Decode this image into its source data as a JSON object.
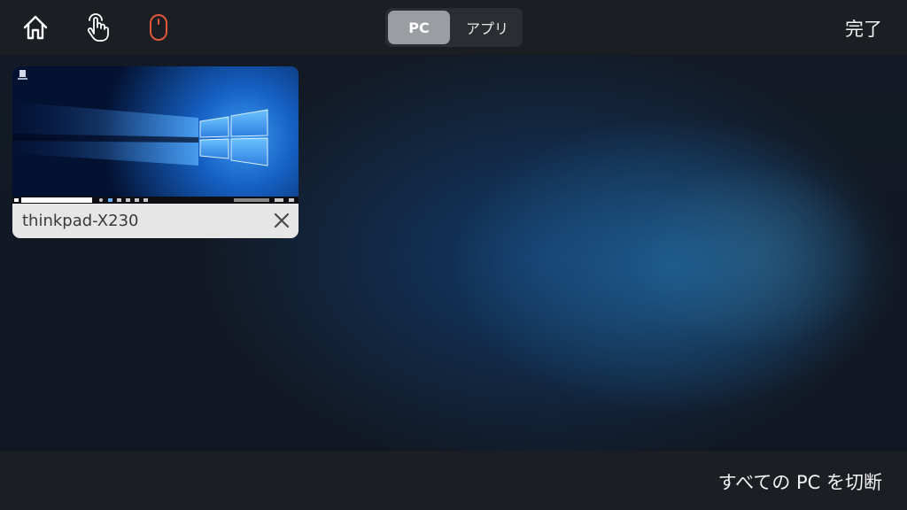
{
  "toolbar": {
    "icons": [
      "home-icon",
      "touch-hand-icon",
      "mouse-icon"
    ],
    "mouse_icon_color": "#e0573a",
    "segments": [
      "PC",
      "アプリ"
    ],
    "selected_segment": "PC",
    "done_label": "完了"
  },
  "sessions": [
    {
      "name": "thinkpad-X230",
      "thumbnail": "windows-10-desktop",
      "close_icon": "close-icon"
    }
  ],
  "footer": {
    "disconnect_label": "すべての PC を切断"
  },
  "colors": {
    "bar_background": "#1b1e23",
    "segment_active": "#9a9da1",
    "card_background": "#e6e6e6"
  }
}
